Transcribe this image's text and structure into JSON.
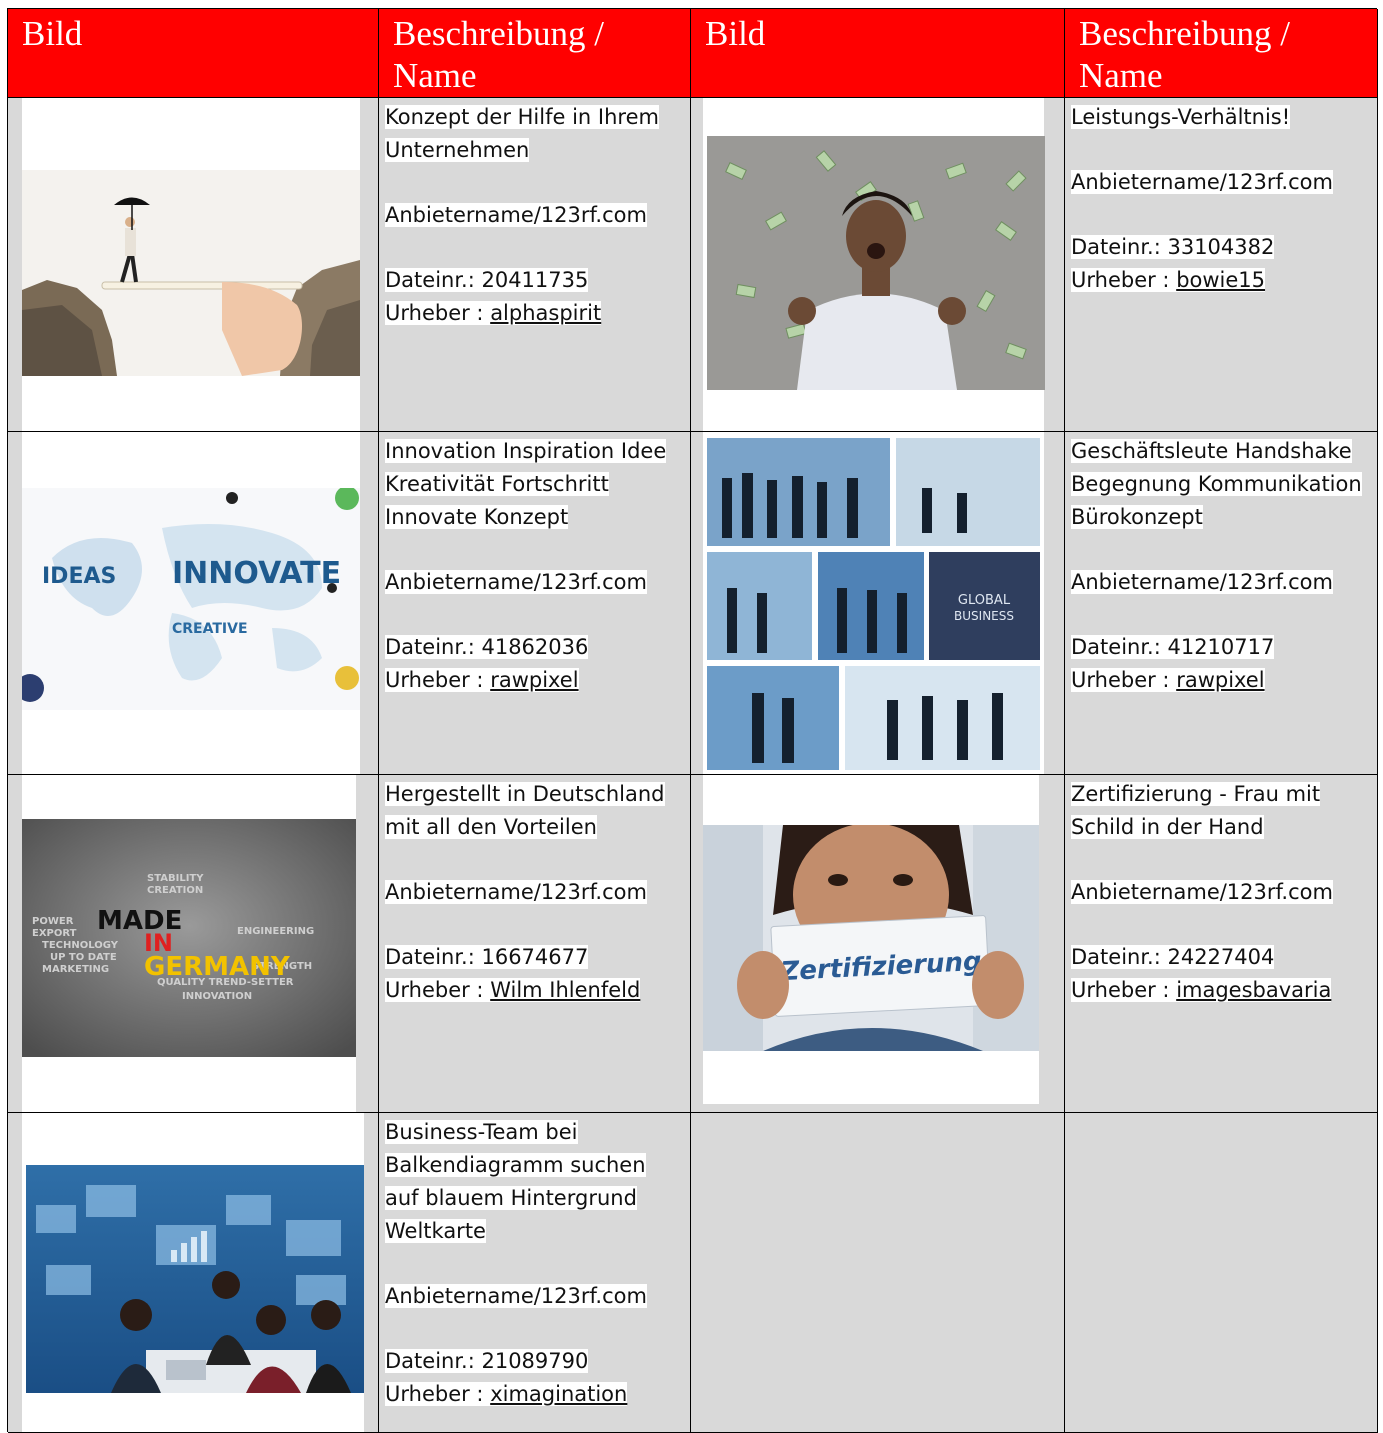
{
  "header": {
    "col1": "Bild",
    "col2": "Beschreibung / Name",
    "col3": "Bild",
    "col4": "Beschreibung / Name"
  },
  "entries": [
    {
      "image": "bridge-pencil-umbrella-photo",
      "title": "Konzept der Hilfe in Ihrem Unternehmen",
      "provider": "Anbietername/123rf.com",
      "file_label": "Dateinr.: 20411735",
      "author_label": "Urheber : ",
      "author": "alphaspirit"
    },
    {
      "image": "man-money-rain-photo",
      "title": "Leistungs-Verhältnis!",
      "provider": "Anbietername/123rf.com",
      "file_label": "Dateinr.: 33104382",
      "author_label": "Urheber : ",
      "author": "bowie15"
    },
    {
      "image": "innovate-wordcloud-photo",
      "title": "Innovation Inspiration Idee Kreativität Fortschritt Innovate Konzept",
      "provider": "Anbietername/123rf.com",
      "file_label": "Dateinr.: 41862036",
      "author_label": "Urheber : ",
      "author": "rawpixel"
    },
    {
      "image": "global-business-collage-photo",
      "title": "Geschäftsleute Handshake Begegnung Kommunikation Bürokonzept",
      "provider": "Anbietername/123rf.com",
      "file_label": "Dateinr.: 41210717",
      "author_label": "Urheber : ",
      "author": "rawpixel"
    },
    {
      "image": "made-in-germany-wordcloud-photo",
      "title": "Hergestellt in Deutschland mit all den Vorteilen",
      "provider": "Anbietername/123rf.com",
      "file_label": "Dateinr.: 16674677",
      "author_label": "Urheber : ",
      "author": "Wilm Ihlenfeld"
    },
    {
      "image": "woman-zertifizierung-sign-photo",
      "title": "Zertifizierung - Frau mit Schild in der Hand",
      "provider": "Anbietername/123rf.com",
      "file_label": "Dateinr.: 24227404",
      "author_label": "Urheber : ",
      "author": "imagesbavaria"
    },
    {
      "image": "business-team-chart-photo",
      "title": "Business-Team bei Balkendiagramm suchen auf blauem Hintergrund Weltkarte",
      "provider": "Anbietername/123rf.com",
      "file_label": "Dateinr.: 21089790",
      "author_label": "Urheber : ",
      "author": "ximagination"
    }
  ],
  "image_text": {
    "innovate": "INNOVATE",
    "ideas": "IDEAS",
    "creative": "CREATIVE",
    "global": "GLOBAL",
    "business": "BUSINESS",
    "made": "MADE",
    "in": "IN",
    "germany": "GERMANY",
    "zertifizierung": "Zertifizierung"
  },
  "colors": {
    "header_bg": "#ff0000",
    "header_text": "#ffffff",
    "cell_bg": "#d9d9d9"
  }
}
